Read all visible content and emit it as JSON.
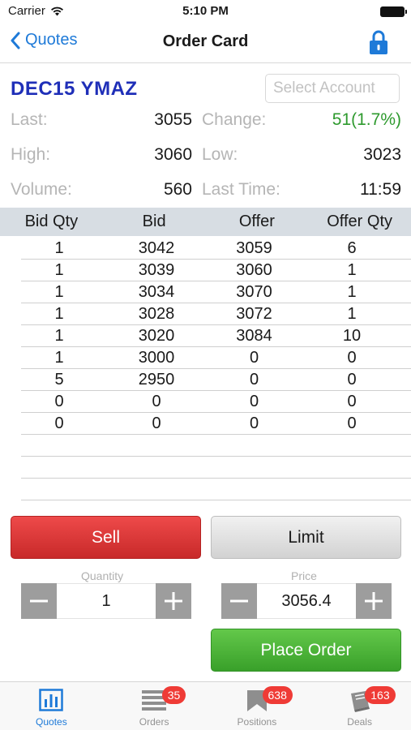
{
  "status": {
    "carrier": "Carrier",
    "time": "5:10 PM"
  },
  "nav": {
    "back_label": "Quotes",
    "title": "Order Card"
  },
  "instrument": {
    "symbol": "DEC15 YMAZ",
    "account_placeholder": "Select Account"
  },
  "stats": {
    "last_label": "Last:",
    "last": "3055",
    "change_label": "Change:",
    "change": "51(1.7%)",
    "high_label": "High:",
    "high": "3060",
    "low_label": "Low:",
    "low": "3023",
    "volume_label": "Volume:",
    "volume": "560",
    "last_time_label": "Last Time:",
    "last_time": "11:59"
  },
  "book": {
    "headers": [
      "Bid Qty",
      "Bid",
      "Offer",
      "Offer Qty"
    ],
    "rows": [
      [
        "1",
        "3042",
        "3059",
        "6"
      ],
      [
        "1",
        "3039",
        "3060",
        "1"
      ],
      [
        "1",
        "3034",
        "3070",
        "1"
      ],
      [
        "1",
        "3028",
        "3072",
        "1"
      ],
      [
        "1",
        "3020",
        "3084",
        "10"
      ],
      [
        "1",
        "3000",
        "0",
        "0"
      ],
      [
        "5",
        "2950",
        "0",
        "0"
      ],
      [
        "0",
        "0",
        "0",
        "0"
      ],
      [
        "0",
        "0",
        "0",
        "0"
      ],
      [
        "",
        "",
        "",
        ""
      ],
      [
        "",
        "",
        "",
        ""
      ],
      [
        "",
        "",
        "",
        ""
      ]
    ]
  },
  "order": {
    "sell_label": "Sell",
    "limit_label": "Limit",
    "quantity_label": "Quantity",
    "quantity": "1",
    "price_label": "Price",
    "price": "3056.4",
    "place_label": "Place Order"
  },
  "tabs": [
    {
      "label": "Quotes",
      "icon": "bar-chart-icon",
      "badge": ""
    },
    {
      "label": "Orders",
      "icon": "list-icon",
      "badge": "35"
    },
    {
      "label": "Positions",
      "icon": "bookmark-icon",
      "badge": "638"
    },
    {
      "label": "Deals",
      "icon": "books-icon",
      "badge": "163"
    }
  ],
  "colors": {
    "accent": "#1e7ad8",
    "symbol": "#1f2fb8",
    "change": "#2e9a2e",
    "sell": "#d93434",
    "place": "#4bb33a"
  }
}
